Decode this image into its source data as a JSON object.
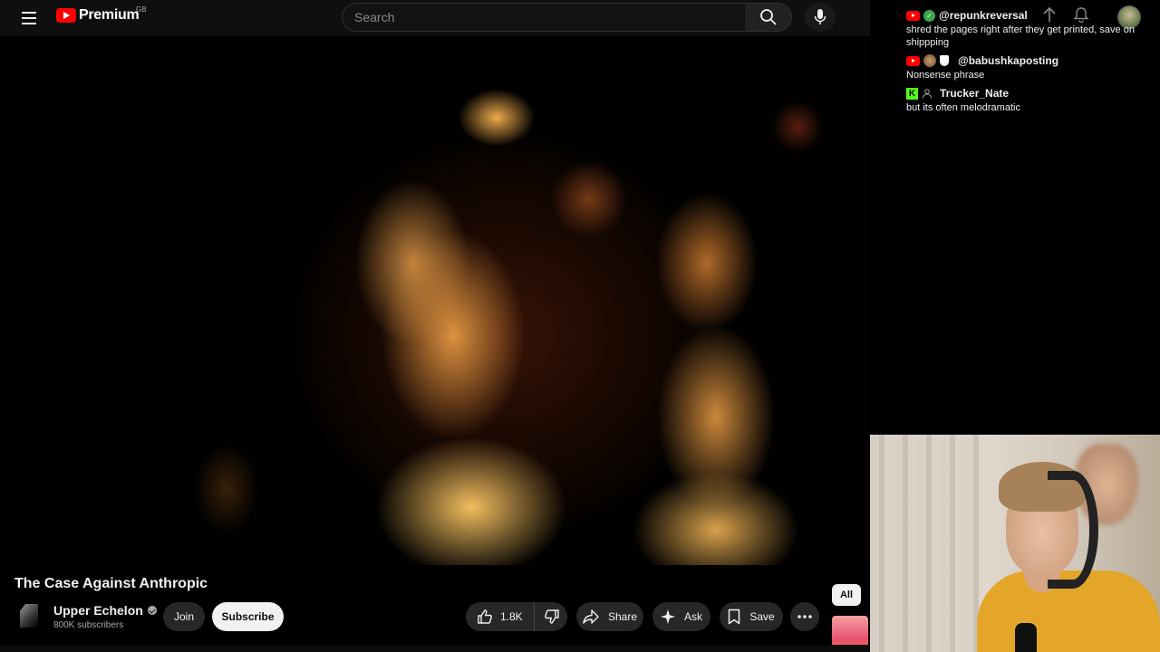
{
  "header": {
    "logo_text": "Premium",
    "region": "GB",
    "search_placeholder": "Search"
  },
  "video": {
    "title": "The Case Against Anthropic"
  },
  "channel": {
    "name": "Upper Echelon",
    "subscribers": "800K subscribers",
    "join_label": "Join",
    "subscribe_label": "Subscribe"
  },
  "actions": {
    "like_count": "1.8K",
    "share_label": "Share",
    "ask_label": "Ask",
    "save_label": "Save"
  },
  "related": {
    "chip_all": "All"
  },
  "chat": {
    "messages": [
      {
        "user": "@repunkreversal",
        "text": "shred the pages right after they get printed, save on shippping",
        "platform": "youtube"
      },
      {
        "user": "@babushkaposting",
        "text": "Nonsense phrase",
        "platform": "youtube"
      },
      {
        "user": "Trucker_Nate",
        "text": "but its often melodramatic",
        "platform": "kick"
      }
    ]
  },
  "colors": {
    "brand_red": "#ff0000",
    "kick_green": "#53fc18",
    "background": "#0f0f0f"
  }
}
